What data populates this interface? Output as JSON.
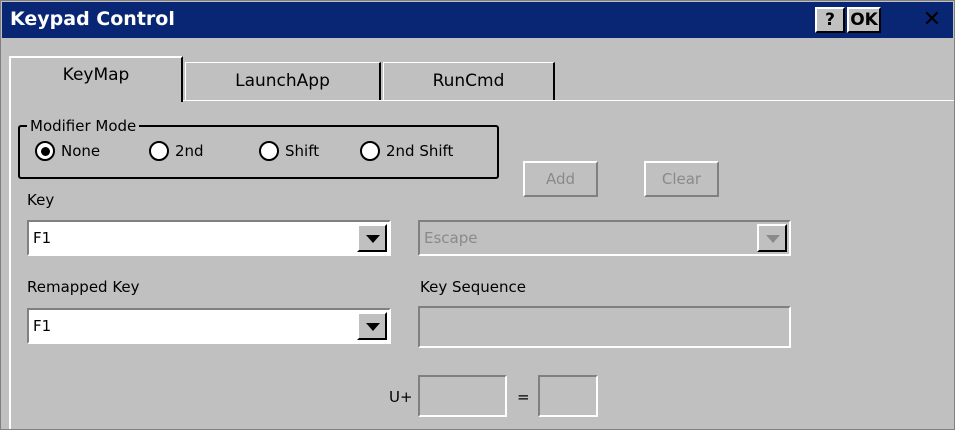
{
  "window": {
    "title": "Keypad Control"
  },
  "title_buttons": {
    "help": "?",
    "ok": "OK",
    "close": "✕"
  },
  "tabs": [
    {
      "label": "KeyMap"
    },
    {
      "label": "LaunchApp"
    },
    {
      "label": "RunCmd"
    }
  ],
  "modifier": {
    "group_label": "Modifier Mode",
    "options": [
      {
        "label": "None"
      },
      {
        "label": "2nd"
      },
      {
        "label": "Shift"
      },
      {
        "label": "2nd Shift"
      }
    ],
    "selected": "None"
  },
  "buttons": {
    "add": "Add",
    "clear": "Clear"
  },
  "key": {
    "label": "Key",
    "value": "F1"
  },
  "sequence_select": {
    "value": "Escape"
  },
  "remapped": {
    "label": "Remapped Key",
    "value": "F1"
  },
  "key_sequence": {
    "label": "Key Sequence",
    "value": ""
  },
  "unicode": {
    "prefix": "U+",
    "equals": "=",
    "code": "",
    "char": ""
  }
}
